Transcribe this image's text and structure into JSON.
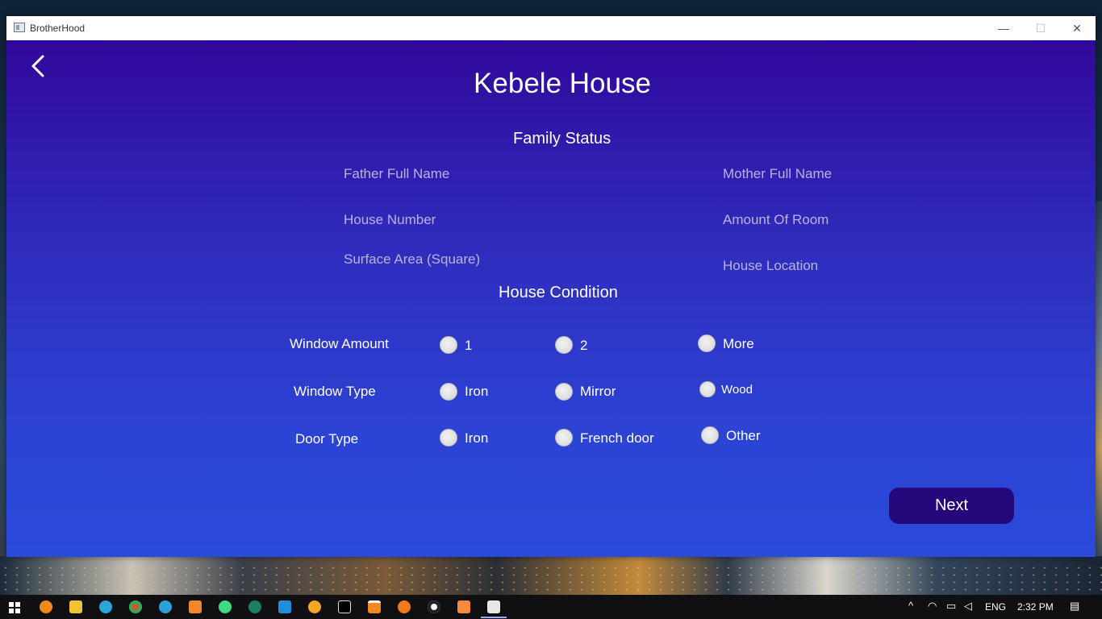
{
  "window": {
    "title": "BrotherHood",
    "controls": {
      "minimize": "—",
      "maximize": "☐",
      "close": "✕"
    }
  },
  "page": {
    "title": "Kebele House",
    "family_section": "Family Status",
    "fields": {
      "father_name": "Father Full Name",
      "mother_name": "Mother Full Name",
      "house_number": "House Number",
      "amount_of_room": "Amount Of Room",
      "surface_area": "Surface Area (Square)",
      "house_location": "House Location"
    },
    "condition_section": "House Condition",
    "window_amount": {
      "label": "Window Amount",
      "options": [
        "1",
        "2",
        "More"
      ]
    },
    "window_type": {
      "label": "Window Type",
      "options": [
        "Iron",
        "Mirror",
        "Wood"
      ]
    },
    "door_type": {
      "label": "Door Type",
      "options": [
        "Iron",
        "French door",
        "Other"
      ]
    },
    "next_button": "Next"
  },
  "taskbar": {
    "language": "ENG",
    "time": "2:32 PM",
    "icons": [
      "windows-start-icon",
      "chrome-canary-icon",
      "file-explorer-icon",
      "edge-icon",
      "chrome-icon",
      "telegram-icon",
      "git-app-icon",
      "android-studio-icon",
      "chatgpt-icon",
      "vscode-icon",
      "blender-icon",
      "intellij-icon",
      "vlc-icon",
      "search-app-icon",
      "obs-icon",
      "xampp-icon",
      "java-app-icon"
    ]
  }
}
